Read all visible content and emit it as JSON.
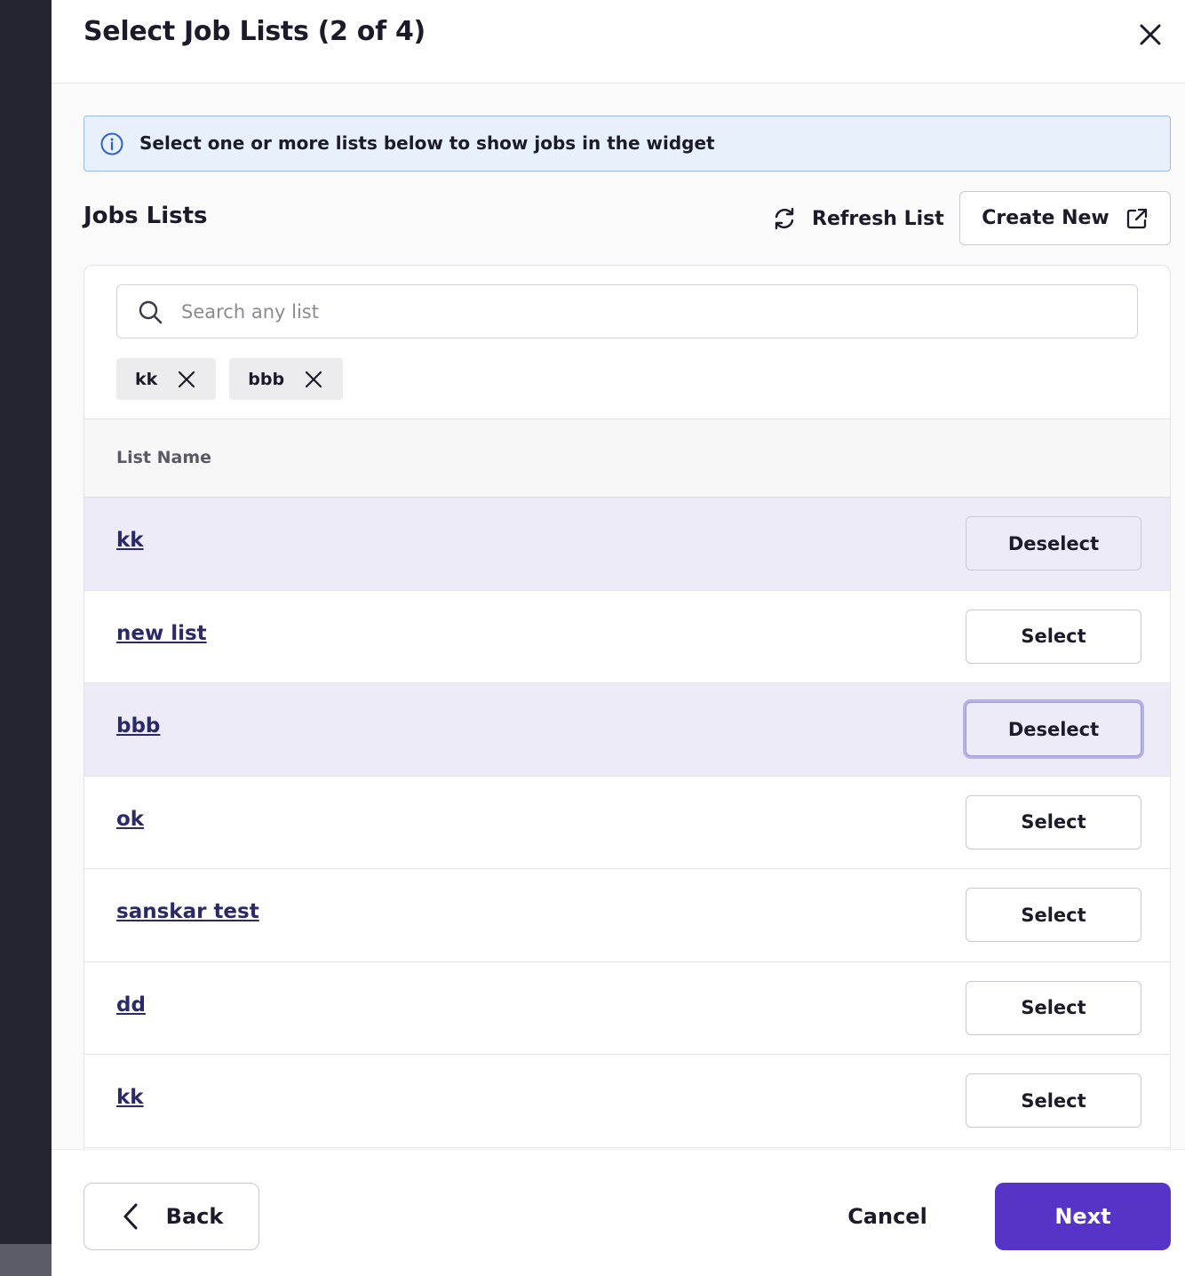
{
  "dialog": {
    "title": "Select Job Lists (2 of 4)"
  },
  "info_banner": {
    "text": "Select one or more lists below to show jobs in the widget",
    "icon": "info-icon"
  },
  "section": {
    "title": "Jobs Lists",
    "refresh_label": "Refresh List",
    "create_label": "Create New"
  },
  "search": {
    "placeholder": "Search any list",
    "value": ""
  },
  "chips": [
    {
      "label": "kk"
    },
    {
      "label": "bbb"
    }
  ],
  "table": {
    "column_header": "List Name",
    "rows": [
      {
        "name": "kk",
        "selected": true,
        "action": "Deselect"
      },
      {
        "name": "new list",
        "selected": false,
        "action": "Select"
      },
      {
        "name": "bbb",
        "selected": true,
        "action": "Deselect"
      },
      {
        "name": "ok",
        "selected": false,
        "action": "Select"
      },
      {
        "name": "sanskar test",
        "selected": false,
        "action": "Select"
      },
      {
        "name": "dd",
        "selected": false,
        "action": "Select"
      },
      {
        "name": "kk",
        "selected": false,
        "action": "Select"
      }
    ]
  },
  "footer": {
    "back_label": "Back",
    "cancel_label": "Cancel",
    "next_label": "Next"
  },
  "colors": {
    "primary": "#5634c8",
    "selected_row": "#ecebf7",
    "info_bg": "#e8f0fc",
    "info_border": "#9dbbe8"
  }
}
